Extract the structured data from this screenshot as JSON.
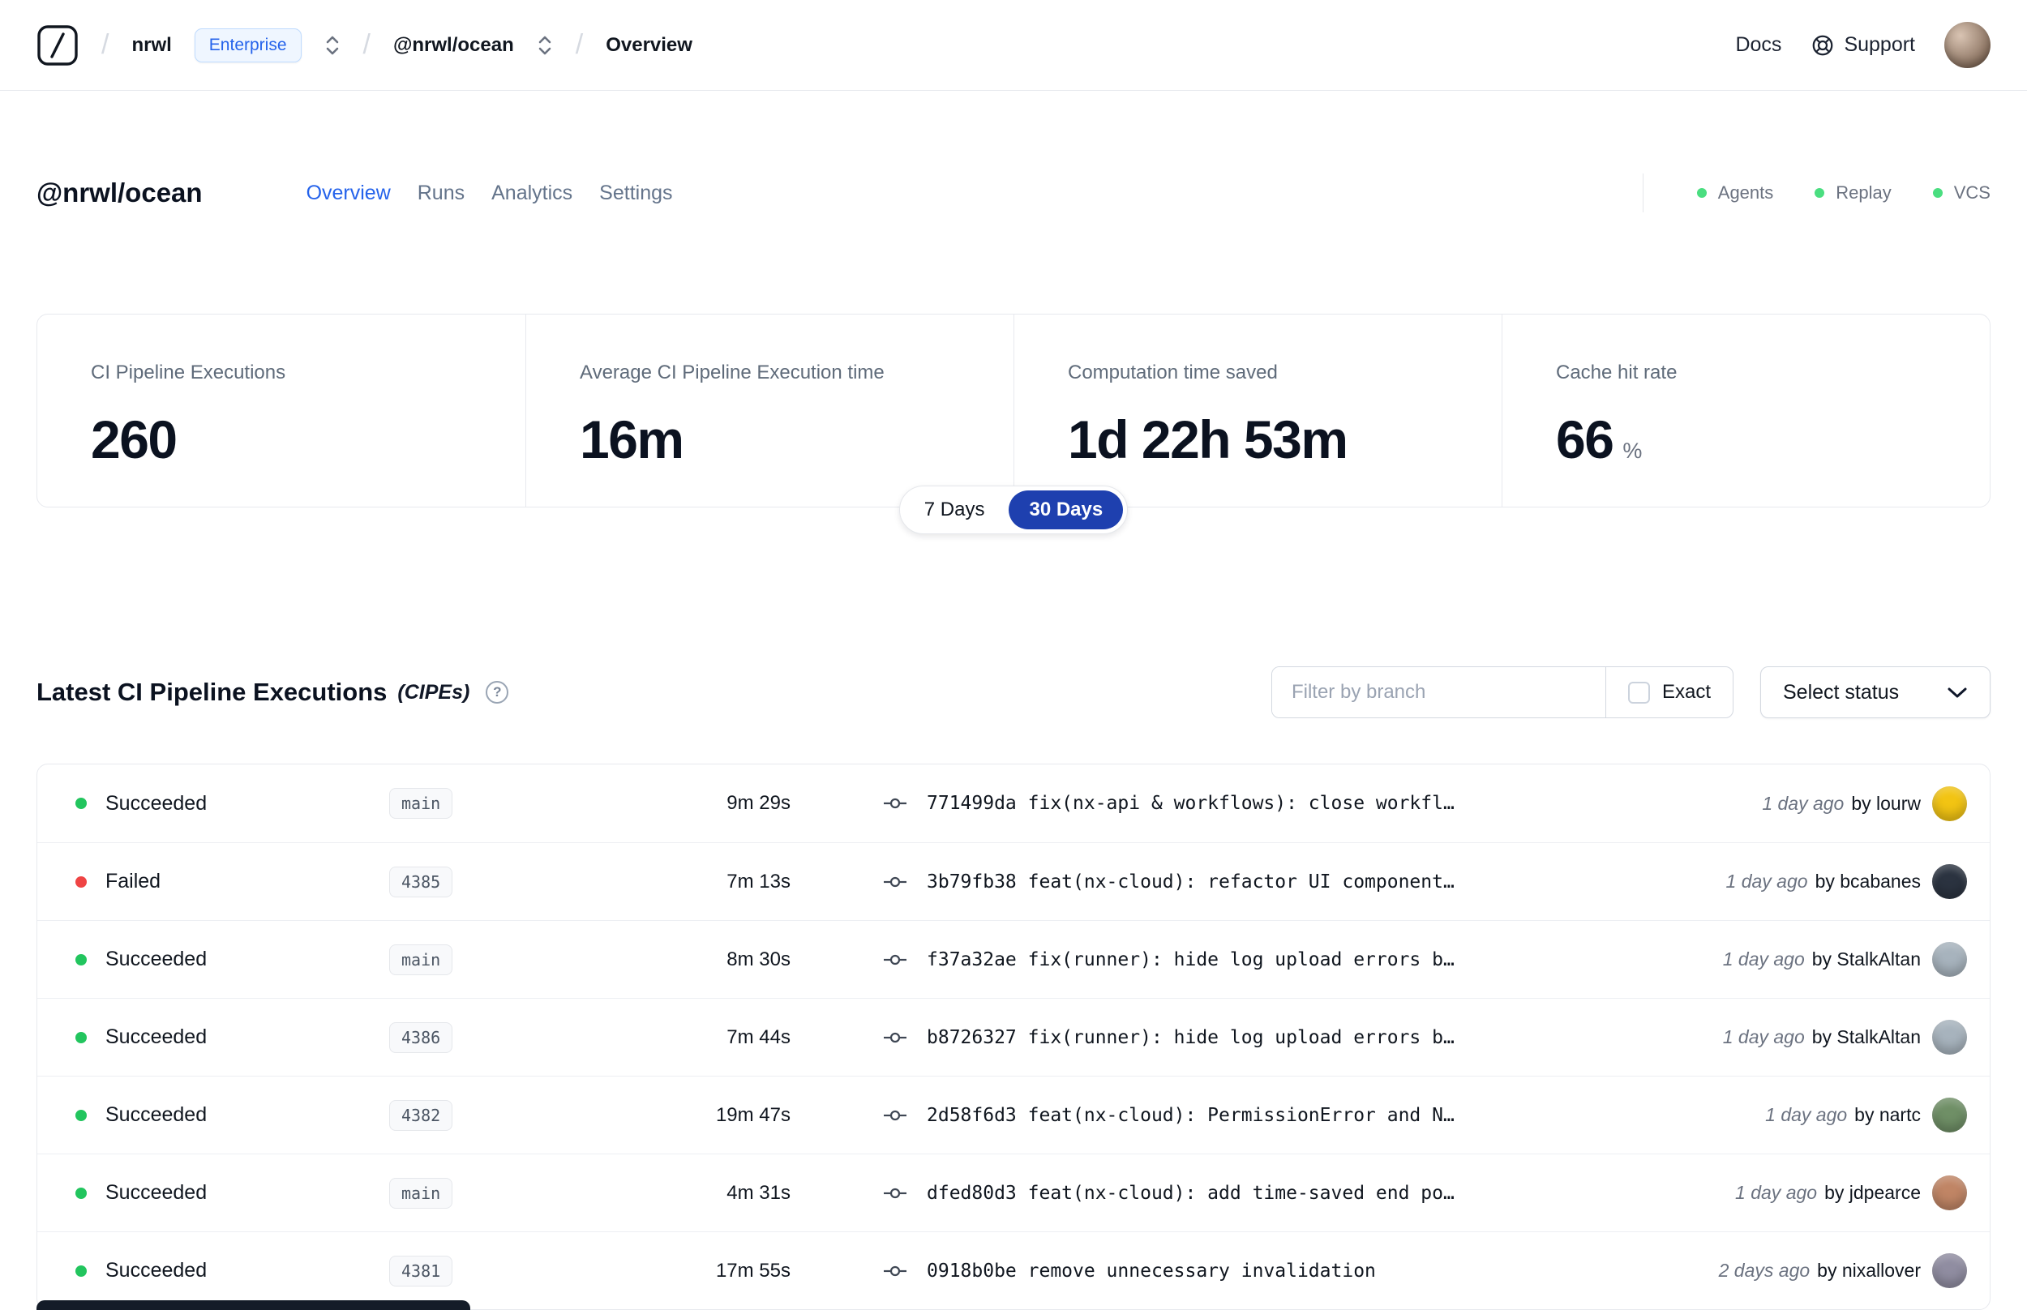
{
  "navbar": {
    "breadcrumb": {
      "workspace": "nrwl",
      "plan": "Enterprise",
      "project": "@nrwl/ocean",
      "page": "Overview"
    },
    "docs": "Docs",
    "support": "Support"
  },
  "header": {
    "title": "@nrwl/ocean",
    "tabs": [
      {
        "label": "Overview",
        "active": true
      },
      {
        "label": "Runs",
        "active": false
      },
      {
        "label": "Analytics",
        "active": false
      },
      {
        "label": "Settings",
        "active": false
      }
    ],
    "statuses": [
      {
        "label": "Agents"
      },
      {
        "label": "Replay"
      },
      {
        "label": "VCS"
      }
    ]
  },
  "stats": {
    "cards": [
      {
        "label": "CI Pipeline Executions",
        "value": "260"
      },
      {
        "label": "Average CI Pipeline Execution time",
        "value": "16m"
      },
      {
        "label": "Computation time saved",
        "value": "1d 22h 53m"
      },
      {
        "label": "Cache hit rate",
        "value": "66",
        "suffix": "%"
      }
    ],
    "range": {
      "options": [
        {
          "label": "7 Days"
        },
        {
          "label": "30 Days"
        }
      ],
      "selected": "30 Days"
    }
  },
  "cipes": {
    "title": "Latest CI Pipeline Executions",
    "title_suffix": "(CIPEs)",
    "filter_placeholder": "Filter by branch",
    "exact_label": "Exact",
    "status_select_label": "Select status",
    "rows": [
      {
        "status": "Succeeded",
        "dot_color": "#22c55e",
        "branch": "main",
        "duration": "9m 29s",
        "commit": "771499da fix(nx-api & workflows): close workfl…",
        "time": "1 day ago",
        "author": "by lourw",
        "avatar_color": "#f2c413"
      },
      {
        "status": "Failed",
        "dot_color": "#ef4444",
        "branch": "4385",
        "duration": "7m 13s",
        "commit": "3b79fb38 feat(nx-cloud): refactor UI component…",
        "time": "1 day ago",
        "author": "by bcabanes",
        "avatar_color": "#2b3340"
      },
      {
        "status": "Succeeded",
        "dot_color": "#22c55e",
        "branch": "main",
        "duration": "8m 30s",
        "commit": "f37a32ae fix(runner): hide log upload errors b…",
        "time": "1 day ago",
        "author": "by StalkAltan",
        "avatar_color": "#a7b3bd"
      },
      {
        "status": "Succeeded",
        "dot_color": "#22c55e",
        "branch": "4386",
        "duration": "7m 44s",
        "commit": "b8726327 fix(runner): hide log upload errors b…",
        "time": "1 day ago",
        "author": "by StalkAltan",
        "avatar_color": "#a7b3bd"
      },
      {
        "status": "Succeeded",
        "dot_color": "#22c55e",
        "branch": "4382",
        "duration": "19m 47s",
        "commit": "2d58f6d3 feat(nx-cloud): PermissionError and N…",
        "time": "1 day ago",
        "author": "by nartc",
        "avatar_color": "#6f8f66"
      },
      {
        "status": "Succeeded",
        "dot_color": "#22c55e",
        "branch": "main",
        "duration": "4m 31s",
        "commit": "dfed80d3 feat(nx-cloud): add time-saved end po…",
        "time": "1 day ago",
        "author": "by jdpearce",
        "avatar_color": "#c08565"
      },
      {
        "status": "Succeeded",
        "dot_color": "#22c55e",
        "branch": "4381",
        "duration": "17m 55s",
        "commit": "0918b0be remove unnecessary invalidation",
        "time": "2 days ago",
        "author": "by nixallover",
        "avatar_color": "#908da1"
      }
    ]
  },
  "colors": {
    "accent": "#2563eb",
    "toggle_active_bg": "#1e40af",
    "success": "#22c55e",
    "danger": "#ef4444"
  }
}
